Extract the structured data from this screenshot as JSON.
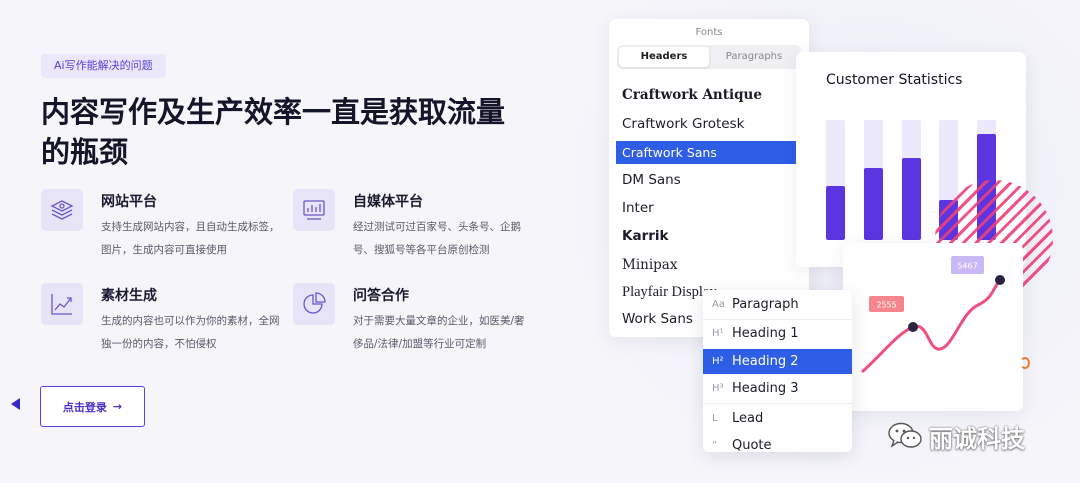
{
  "hero": {
    "tag": "Ai写作能解决的问题",
    "headline_line1": "内容写作及生产效率一直是获取流量",
    "headline_line2": "的瓶颈"
  },
  "features": [
    {
      "title": "网站平台",
      "desc": "支持生成网站内容，且自动生成标签，图片，生成内容可直接使用",
      "icon": "layers-icon"
    },
    {
      "title": "自媒体平台",
      "desc": "经过测试可过百家号、头条号、企鹅号、搜狐号等各平台原创检测",
      "icon": "media-chart-icon"
    },
    {
      "title": "素材生成",
      "desc": "生成的内容也可以作为你的素材，全网独一份的内容，不怕侵权",
      "icon": "trend-chart-icon"
    },
    {
      "title": "问答合作",
      "desc": "对于需要大量文章的企业，如医美/奢侈品/法律/加盟等行业可定制",
      "icon": "pie-chart-icon"
    }
  ],
  "cta": {
    "login_label": "点击登录",
    "arrow": "→"
  },
  "fonts_panel": {
    "title": "Fonts",
    "tabs": [
      "Headers",
      "Paragraphs"
    ],
    "active_tab": "Headers",
    "items": [
      "Craftwork Antique",
      "Craftwork Grotesk",
      "Craftwork Sans",
      "DM Sans",
      "Inter",
      "Karrik",
      "Minipax",
      "Playfair Display",
      "Work Sans"
    ],
    "selected": "Craftwork Sans"
  },
  "stats_card": {
    "title": "Customer Statistics",
    "bar_levels": [
      0.45,
      0.6,
      0.68,
      0.33,
      0.88
    ],
    "bar_color": "#5b35e0",
    "track_color": "#ebe9fb"
  },
  "line_chart": {
    "labels": [
      "2555",
      "5467"
    ],
    "line_color": "#ef4f7f",
    "label_colors": [
      "#f5868e",
      "#c9b8f5"
    ]
  },
  "paragraph_menu": {
    "items": [
      {
        "icon": "Aa",
        "label": "Paragraph"
      },
      {
        "icon": "H¹",
        "label": "Heading 1"
      },
      {
        "icon": "H²",
        "label": "Heading 2"
      },
      {
        "icon": "H³",
        "label": "Heading 3"
      },
      {
        "icon": "L",
        "label": "Lead"
      },
      {
        "icon": "“",
        "label": "Quote"
      }
    ],
    "selected": "Heading 2"
  },
  "watermark": {
    "text": "丽诚科技",
    "icon": "wechat-icon"
  },
  "colors": {
    "accent": "#5b3de0",
    "selection_blue": "#2e5de6",
    "pink": "#ef3f78"
  }
}
